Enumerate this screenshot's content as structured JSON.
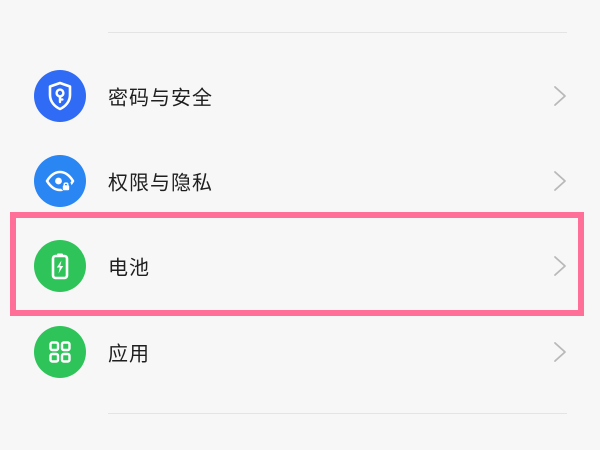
{
  "settings": {
    "items": [
      {
        "label": "密码与安全",
        "icon": "shield-key-icon",
        "icon_color": "#2f6bf5"
      },
      {
        "label": "权限与隐私",
        "icon": "eye-lock-icon",
        "icon_color": "#2a86f3"
      },
      {
        "label": "电池",
        "icon": "battery-charging-icon",
        "icon_color": "#2fc45a"
      },
      {
        "label": "应用",
        "icon": "apps-grid-icon",
        "icon_color": "#2fc45a"
      }
    ]
  },
  "highlight": {
    "target": "电池",
    "color": "#ff6f98"
  }
}
